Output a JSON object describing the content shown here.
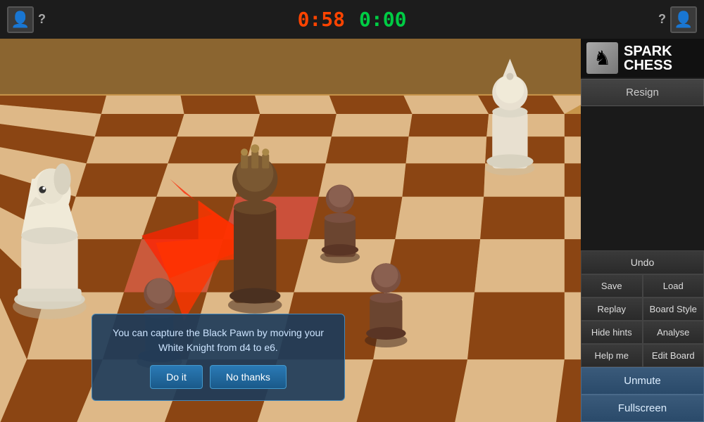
{
  "header": {
    "player_left_avatar": "👤",
    "player_left_name": "?",
    "timer_red": "0:58",
    "timer_green": "0:00",
    "player_right_avatar": "👤",
    "player_right_name": "?"
  },
  "brand": {
    "icon": "♞",
    "spark": "SPARK",
    "chess": "CHESS"
  },
  "sidebar": {
    "resign_label": "Resign",
    "undo_label": "Undo",
    "save_label": "Save",
    "load_label": "Load",
    "replay_label": "Replay",
    "board_style_label": "Board Style",
    "hide_hints_label": "Hide hints",
    "analyse_label": "Analyse",
    "help_me_label": "Help me",
    "edit_board_label": "Edit Board",
    "unmute_label": "Unmute",
    "fullscreen_label": "Fullscreen"
  },
  "hint_dialog": {
    "message": "You can capture the Black Pawn by moving your White Knight from d4 to e6.",
    "do_it_label": "Do it",
    "no_thanks_label": "No thanks"
  }
}
